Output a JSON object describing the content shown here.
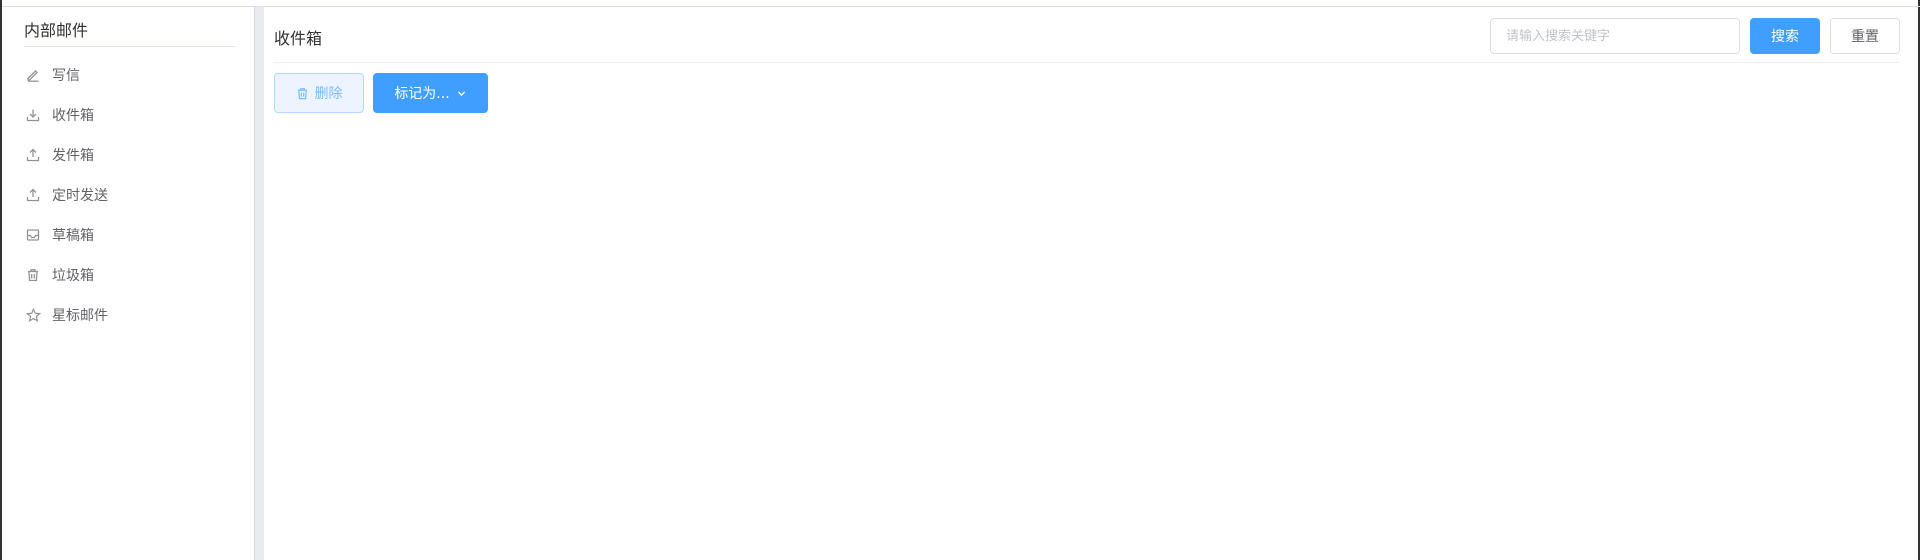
{
  "sidebar": {
    "title": "内部邮件",
    "items": [
      {
        "label": "写信",
        "icon": "edit-icon"
      },
      {
        "label": "收件箱",
        "icon": "download-icon"
      },
      {
        "label": "发件箱",
        "icon": "upload-icon"
      },
      {
        "label": "定时发送",
        "icon": "upload-icon"
      },
      {
        "label": "草稿箱",
        "icon": "inbox-icon"
      },
      {
        "label": "垃圾箱",
        "icon": "trash-icon"
      },
      {
        "label": "星标邮件",
        "icon": "star-icon"
      }
    ]
  },
  "main": {
    "title": "收件箱",
    "search": {
      "placeholder": "请输入搜索关键字",
      "value": ""
    },
    "search_button": "搜索",
    "reset_button": "重置",
    "toolbar": {
      "delete_label": "删除",
      "mark_label": "标记为..."
    }
  },
  "colors": {
    "primary": "#409eff",
    "primary_light": "#ecf5ff",
    "text": "#303133",
    "muted": "#909399"
  }
}
